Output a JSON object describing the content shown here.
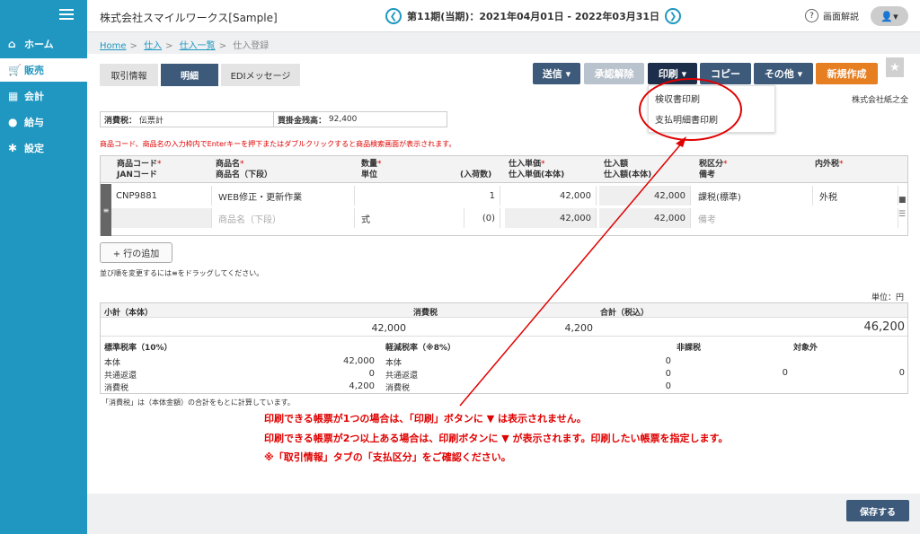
{
  "header": {
    "company": "株式会社スマイルワークス[Sample]",
    "period": "第11期(当期)：2021年04月01日 - 2022年03月31日",
    "help": "画面解説"
  },
  "sidebar": {
    "items": [
      {
        "label": "ホーム",
        "icon": "home-icon"
      },
      {
        "label": "販売",
        "icon": "cart-icon"
      },
      {
        "label": "会計",
        "icon": "calculator-icon"
      },
      {
        "label": "給与",
        "icon": "money-bag-icon"
      },
      {
        "label": "設定",
        "icon": "gear-icon"
      }
    ]
  },
  "breadcrumb": [
    "Home",
    "仕入",
    "仕入一覧",
    "仕入登録"
  ],
  "tabs": [
    "取引情報",
    "明細",
    "EDIメッセージ"
  ],
  "toolbar": {
    "send": "送信",
    "unapprove": "承認解除",
    "print": "印刷",
    "copy": "コピー",
    "other": "その他",
    "new": "新規作成"
  },
  "print_menu": [
    "検収書印刷",
    "支払明細書印刷"
  ],
  "company_seal_label": "株式会社紙之全",
  "info": {
    "tax_label": "消費税：",
    "tax_value": "伝票計",
    "payable_label": "買掛金残高：",
    "payable_value": "92,400"
  },
  "instruction": "商品コード、商品名の入力枠内でEnterキーを押下またはダブルクリックすると商品検索画面が表示されます。",
  "grid_header": {
    "code": "商品コード",
    "jan": "JANコード",
    "name": "商品名",
    "name2": "商品名（下段）",
    "qty": "数量",
    "unit": "単位",
    "in_qty": "(入荷数)",
    "price": "仕入単価",
    "price2": "仕入単価(本体)",
    "amount": "仕入額",
    "amount2": "仕入額(本体)",
    "taxclass": "税区分",
    "remarks": "備考",
    "taxincl": "内外税",
    "req": "*"
  },
  "grid_row": {
    "code": "CNP9881",
    "name": "WEB修正・更新作業",
    "name2_placeholder": "商品名（下段）",
    "qty": "1",
    "unit": "式",
    "in_qty": "(0)",
    "price": "42,000",
    "price2": "42,000",
    "amount": "42,000",
    "amount2": "42,000",
    "taxclass": "課税(標準)",
    "remarks_placeholder": "備考",
    "taxincl": "外税"
  },
  "add_row": "+ 行の追加",
  "drag_note": "並び順を変更するには≡をドラッグしてください。",
  "unit_label": "単位：円",
  "summary": {
    "subtotal_label": "小計（本体）",
    "subtotal": "42,000",
    "tax_label": "消費税",
    "tax": "4,200",
    "total_label": "合計（税込）",
    "total": "46,200",
    "std_label": "標準税率（10%）",
    "red_label": "軽減税率（※8%）",
    "nontax_label": "非課税",
    "exempt_label": "対象外",
    "row_labels": [
      "本体",
      "共通返還",
      "消費税"
    ],
    "std_values": [
      "42,000",
      "0",
      "4,200"
    ],
    "red_values": [
      "0",
      "0",
      "0"
    ],
    "nontax": "0",
    "exempt": "0"
  },
  "calc_note": "「消費税」は（本体金額）の合計をもとに計算しています。",
  "annotations": [
    "印刷できる帳票が1つの場合は、「印刷」ボタンに ▼ は表示されません。",
    "印刷できる帳票が2つ以上ある場合は、印刷ボタンに ▼ が表示されます。印刷したい帳票を指定します。",
    "※「取引情報」タブの「支払区分」をご確認ください。"
  ],
  "save": "保存する",
  "colors": {
    "sidebar": "#1f97c0",
    "accent_red": "#e00000",
    "navy": "#3d5a7a",
    "orange": "#e67e22"
  }
}
